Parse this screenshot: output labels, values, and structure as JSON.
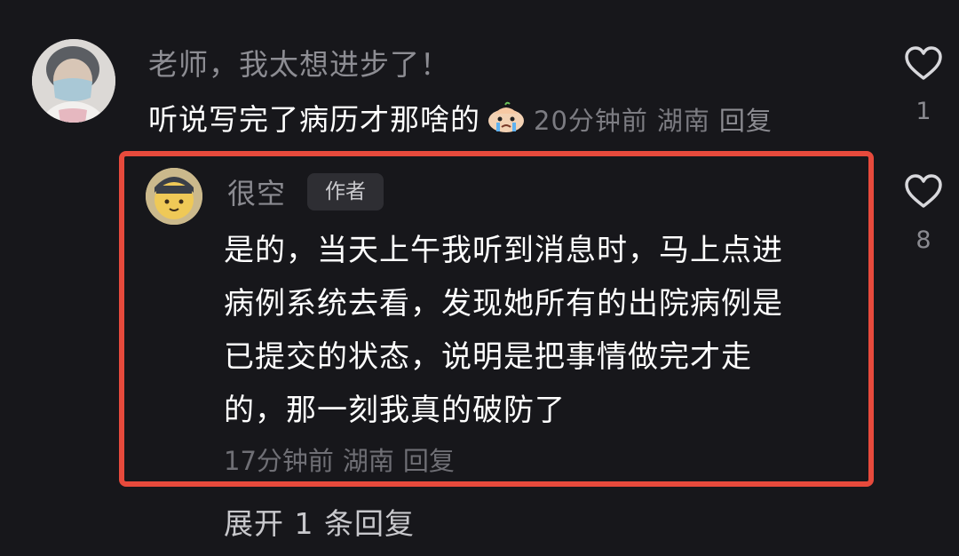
{
  "comment": {
    "username": "老师，我太想进步了！",
    "text": "听说写完了病历才那啥的",
    "emoji_icon": "crying-face-emoji-icon",
    "time": "20分钟前",
    "location": "湖南",
    "reply_label": "回复",
    "likes": "1"
  },
  "reply": {
    "username": "很空",
    "badge": "作者",
    "lines": [
      "是的，当天上午我听到消息时，马上点进",
      "病例系统去看，发现她所有的出院病例是",
      "已提交的状态，说明是把事情做完才走",
      "的，那一刻我真的破防了"
    ],
    "time": "17分钟前",
    "location": "湖南",
    "reply_label": "回复",
    "likes": "8"
  },
  "expand_label": "展开 1 条回复",
  "colors": {
    "background": "#17171b",
    "highlight_border": "#e74a3c",
    "primary_text": "#ffffff",
    "secondary_text": "#8d8d93"
  }
}
